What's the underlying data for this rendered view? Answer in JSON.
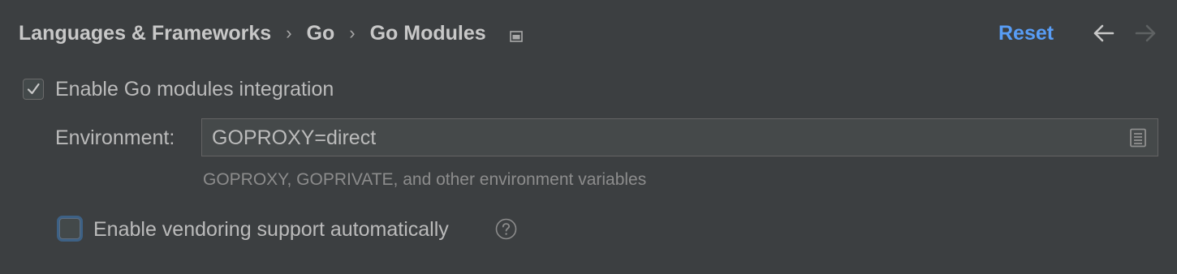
{
  "header": {
    "breadcrumb": [
      "Languages & Frameworks",
      "Go",
      "Go Modules"
    ],
    "separator": "›",
    "project_icon": "project-scope-icon",
    "reset_label": "Reset",
    "back_icon": "arrow-left-icon",
    "forward_icon": "arrow-right-icon"
  },
  "settings": {
    "enable_modules": {
      "label": "Enable Go modules integration",
      "checked": true
    },
    "environment": {
      "label": "Environment:",
      "value": "GOPROXY=direct",
      "hint": "GOPROXY, GOPRIVATE, and other environment variables",
      "expand_icon": "expand-field-icon"
    },
    "vendoring": {
      "label": "Enable vendoring support automatically",
      "checked": false,
      "help_icon": "question-circle-icon"
    }
  },
  "colors": {
    "background": "#3c3f41",
    "text": "#bbbbbb",
    "link": "#589df6",
    "hint": "#8c8c8c",
    "focus": "#3d6185"
  }
}
